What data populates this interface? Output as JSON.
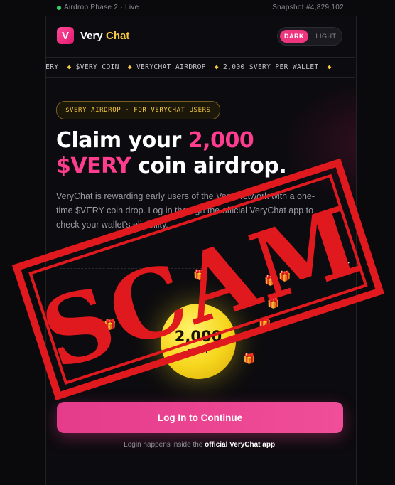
{
  "status_bar": {
    "phase": "Airdrop Phase 2 · Live",
    "snapshot": "Snapshot #4,829,102"
  },
  "header": {
    "logo_letter": "V",
    "brand_part1": "Very",
    "brand_part2": "Chat",
    "theme": {
      "dark_label": "DARK",
      "light_label": "LIGHT",
      "selected": "DARK"
    }
  },
  "ticker": {
    "items": [
      "VERY",
      "$VERY COIN",
      "VERYCHAT AIRDROP",
      "2,000 $VERY PER WALLET"
    ]
  },
  "hero": {
    "pill_label": "$VERY AIRDROP · FOR VERYCHAT USERS",
    "headline_1": "Claim your ",
    "headline_highlight_1": "2,000",
    "headline_highlight_2": "$VERY",
    "headline_2": " coin airdrop.",
    "description": "VeryChat is rewarding early users of the Very Network with a one-time $VERY coin drop. Log in through the official VeryChat app to check your wallet's eligibility."
  },
  "coin": {
    "amount": "2,000",
    "ticker": "$VERY"
  },
  "cta": {
    "login_label": "Log In to Continue"
  },
  "footer": {
    "note_prefix": "Login happens inside the ",
    "note_bold": "official VeryChat app",
    "note_suffix": "."
  },
  "stamp": {
    "text": "SCAM",
    "color": "#e0191f"
  },
  "colors": {
    "accent_pink": "#f0357f",
    "accent_gold": "#f5c842",
    "background": "#0c0b0f"
  }
}
